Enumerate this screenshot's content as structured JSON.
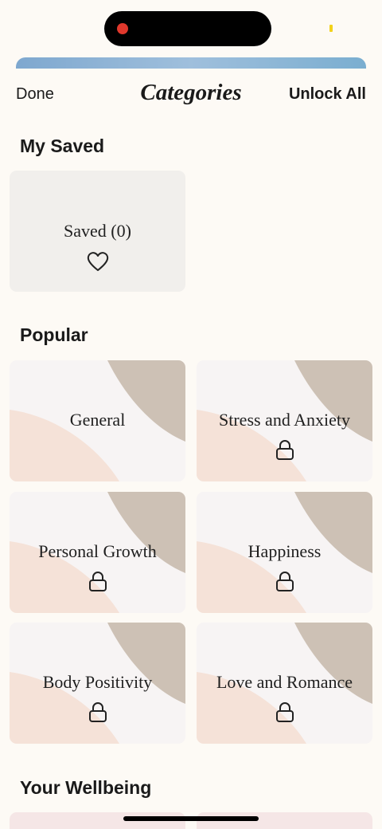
{
  "header": {
    "done_label": "Done",
    "title": "Categories",
    "unlock_label": "Unlock All"
  },
  "sections": {
    "saved": {
      "heading": "My Saved"
    },
    "popular": {
      "heading": "Popular"
    },
    "wellbeing": {
      "heading": "Your Wellbeing"
    }
  },
  "saved_card": {
    "label": "Saved (0)",
    "icon": "heart-icon"
  },
  "popular_cards": [
    {
      "label": "General",
      "locked": false
    },
    {
      "label": "Stress and Anxiety",
      "locked": true,
      "icon": "lock-icon"
    },
    {
      "label": "Personal Growth",
      "locked": true,
      "icon": "lock-icon"
    },
    {
      "label": "Happiness",
      "locked": true,
      "icon": "lock-icon"
    },
    {
      "label": "Body Positivity",
      "locked": true,
      "icon": "lock-icon"
    },
    {
      "label": "Love and Romance",
      "locked": true,
      "icon": "lock-icon"
    }
  ],
  "colors": {
    "background": "#fdfaf5",
    "card_base": "#f7f4f4",
    "card_taupe": "#cdc1b5",
    "card_peach": "#f5e2d8",
    "saved_card": "#f1efec",
    "recording_dot": "#e0382c"
  }
}
